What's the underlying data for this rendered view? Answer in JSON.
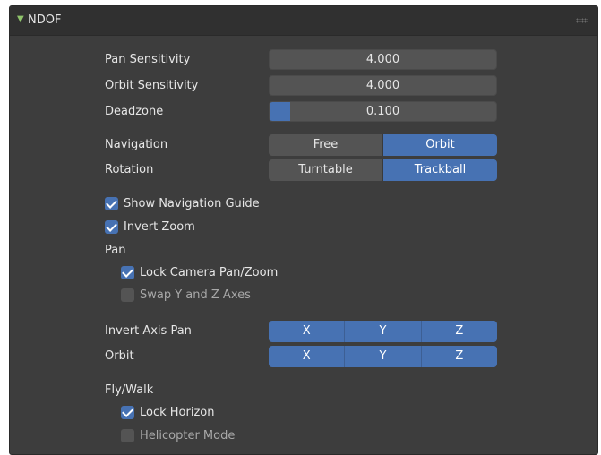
{
  "panel": {
    "title": "NDOF"
  },
  "fields": {
    "pan_sensitivity": {
      "label": "Pan Sensitivity",
      "value": "4.000"
    },
    "orbit_sensitivity": {
      "label": "Orbit Sensitivity",
      "value": "4.000"
    },
    "deadzone": {
      "label": "Deadzone",
      "value": "0.100",
      "fill_fraction": 0.1
    }
  },
  "navigation": {
    "label": "Navigation",
    "options": [
      "Free",
      "Orbit"
    ],
    "selected": "Orbit"
  },
  "rotation": {
    "label": "Rotation",
    "options": [
      "Turntable",
      "Trackball"
    ],
    "selected": "Trackball"
  },
  "checks": {
    "show_nav_guide": {
      "label": "Show Navigation Guide",
      "checked": true
    },
    "invert_zoom": {
      "label": "Invert Zoom",
      "checked": true
    },
    "lock_camera": {
      "label": "Lock Camera Pan/Zoom",
      "checked": true
    },
    "swap_yz": {
      "label": "Swap Y and Z Axes",
      "checked": false
    },
    "lock_horizon": {
      "label": "Lock Horizon",
      "checked": true
    },
    "helicopter": {
      "label": "Helicopter Mode",
      "checked": false
    }
  },
  "sections": {
    "pan": "Pan",
    "fly_walk": "Fly/Walk"
  },
  "invert_axis_pan": {
    "label": "Invert Axis Pan",
    "axes": [
      "X",
      "Y",
      "Z"
    ]
  },
  "orbit_axes": {
    "label": "Orbit",
    "axes": [
      "X",
      "Y",
      "Z"
    ]
  },
  "colors": {
    "accent": "#4772b3",
    "panel_bg": "#3d3d3d",
    "field_bg": "#545454"
  }
}
